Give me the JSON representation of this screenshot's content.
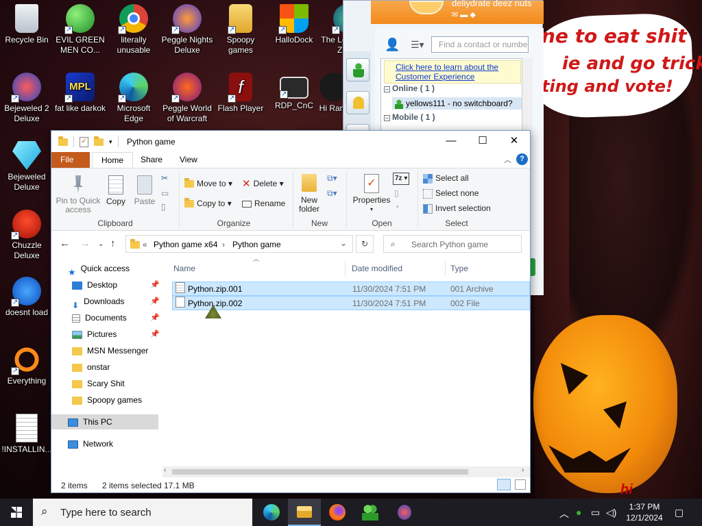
{
  "wallpaper": {
    "bubble_lines": [
      "ne to eat shit",
      "ie and go trick",
      "ting and vote!"
    ],
    "corner_text": "hi"
  },
  "desktop_icons": [
    {
      "label": "Recycle Bin"
    },
    {
      "label": "EVIL GREEN MEN CO..."
    },
    {
      "label": "literally unusable"
    },
    {
      "label": "Peggle Nights Deluxe"
    },
    {
      "label": "Spoopy games"
    },
    {
      "label": "HalloDock"
    },
    {
      "label": "The Legend of Zelda"
    },
    {
      "label": "Bejeweled 2 Deluxe"
    },
    {
      "label": "fat like darkok"
    },
    {
      "label": "Microsoft Edge"
    },
    {
      "label": "Peggle World of Warcraft"
    },
    {
      "label": "Flash Player"
    },
    {
      "label": "RDP_CnC"
    },
    {
      "label": "Hi Rans"
    },
    {
      "label": "Bejeweled Deluxe"
    },
    {
      "label": "Chuzzle Deluxe"
    },
    {
      "label": "doesnt load"
    },
    {
      "label": "Everything"
    },
    {
      "label": "!INSTALLIN..."
    }
  ],
  "msn": {
    "header_text": "deliydrate deez nuts",
    "find_placeholder": "Find a contact or number...",
    "info_link": "Click here to learn about the Customer Experience",
    "groups": [
      {
        "label": "Online ( 1 )"
      },
      {
        "label": "Mobile ( 1 )"
      }
    ],
    "contacts": [
      {
        "name": "yellows111 - no switchboard?"
      }
    ]
  },
  "explorer": {
    "title": "Python game",
    "tabs": {
      "file": "File",
      "home": "Home",
      "share": "Share",
      "view": "View"
    },
    "ribbon": {
      "clipboard": {
        "pin_quick_access": "Pin to Quick access",
        "copy": "Copy",
        "paste": "Paste",
        "label": "Clipboard"
      },
      "organize": {
        "move_to": "Move to",
        "copy_to": "Copy to",
        "delete": "Delete",
        "rename": "Rename",
        "label": "Organize"
      },
      "new": {
        "new_folder": "New folder",
        "label": "New"
      },
      "open": {
        "properties": "Properties",
        "label": "Open"
      },
      "select": {
        "select_all": "Select all",
        "select_none": "Select none",
        "invert_selection": "Invert selection",
        "label": "Select"
      }
    },
    "address": {
      "crumb_1": "Python game x64",
      "crumb_2": "Python game"
    },
    "search_placeholder": "Search Python game",
    "nav": {
      "quick_access": "Quick access",
      "items": [
        {
          "label": "Desktop",
          "pinned": true
        },
        {
          "label": "Downloads",
          "pinned": true
        },
        {
          "label": "Documents",
          "pinned": true
        },
        {
          "label": "Pictures",
          "pinned": true
        },
        {
          "label": "MSN Messenger",
          "pinned": false
        },
        {
          "label": "onstar",
          "pinned": false
        },
        {
          "label": "Scary Shit",
          "pinned": false
        },
        {
          "label": "Spoopy games",
          "pinned": false
        }
      ],
      "this_pc": "This PC",
      "network": "Network"
    },
    "columns": {
      "name": "Name",
      "date": "Date modified",
      "type": "Type"
    },
    "files": [
      {
        "name": "Python.zip.001",
        "date": "11/30/2024 7:51 PM",
        "type": "001 Archive",
        "selected": true
      },
      {
        "name": "Python.zip.002",
        "date": "11/30/2024 7:51 PM",
        "type": "002 File",
        "selected": true
      }
    ],
    "status": {
      "items": "2 items",
      "selected": "2 items selected",
      "size": "17.1 MB"
    }
  },
  "taskbar": {
    "search_placeholder": "Type here to search",
    "time": "1:37 PM",
    "date": "12/1/2024"
  },
  "colors": {
    "accent": "#0078d7",
    "file_tab": "#c45b1c",
    "selection": "#cce8ff",
    "taskbar": "#1c1c22",
    "msn_orange": "#f28a1a"
  }
}
